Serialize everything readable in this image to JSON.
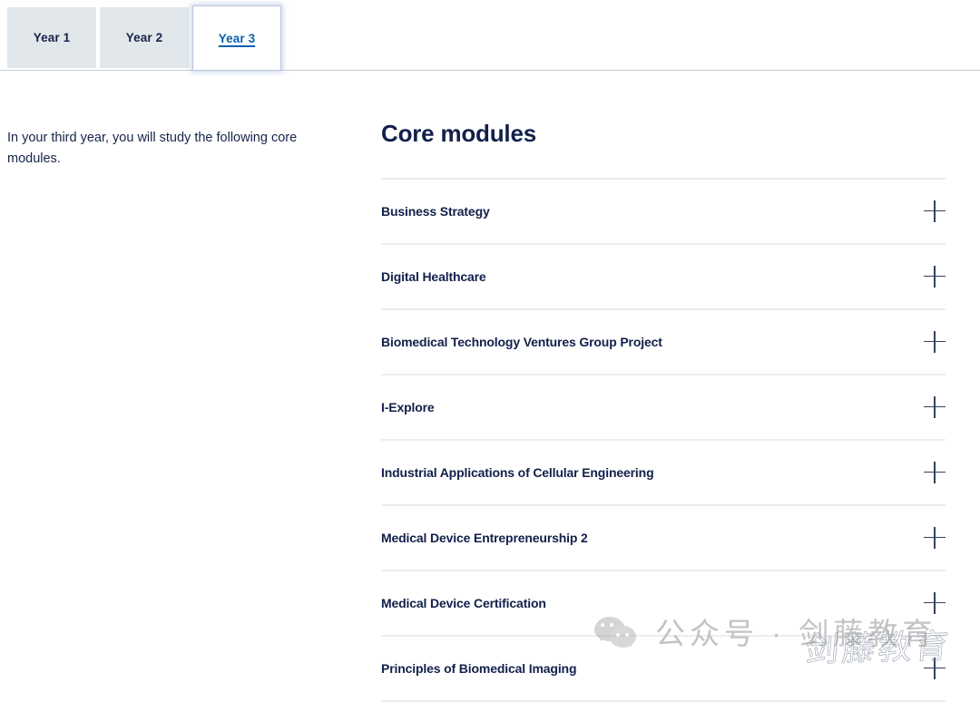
{
  "tabs": [
    {
      "label": "Year 1",
      "active": false
    },
    {
      "label": "Year 2",
      "active": false
    },
    {
      "label": "Year 3",
      "active": true
    }
  ],
  "intro": {
    "text": "In your third year, you will study the following core modules."
  },
  "modules_panel": {
    "heading": "Core modules",
    "expand_icon": "plus-icon",
    "items": [
      {
        "title": "Business Strategy"
      },
      {
        "title": "Digital Healthcare"
      },
      {
        "title": "Biomedical Technology Ventures Group Project"
      },
      {
        "title": "I-Explore"
      },
      {
        "title": "Industrial Applications of Cellular Engineering"
      },
      {
        "title": "Medical Device Entrepreneurship 2"
      },
      {
        "title": "Medical Device Certification"
      },
      {
        "title": "Principles of Biomedical Imaging"
      }
    ]
  },
  "watermark": {
    "icon": "wechat-icon",
    "text": "公众号 · 剑藤教育",
    "script_text": "剑藤教育"
  },
  "colors": {
    "navy": "#16244a",
    "heading_navy": "#12204a",
    "link_blue": "#0b5fb0",
    "tab_inactive_bg": "#e1e7ea",
    "divider": "#eceded",
    "rule": "#c9ced6",
    "plus": "#33425e"
  }
}
